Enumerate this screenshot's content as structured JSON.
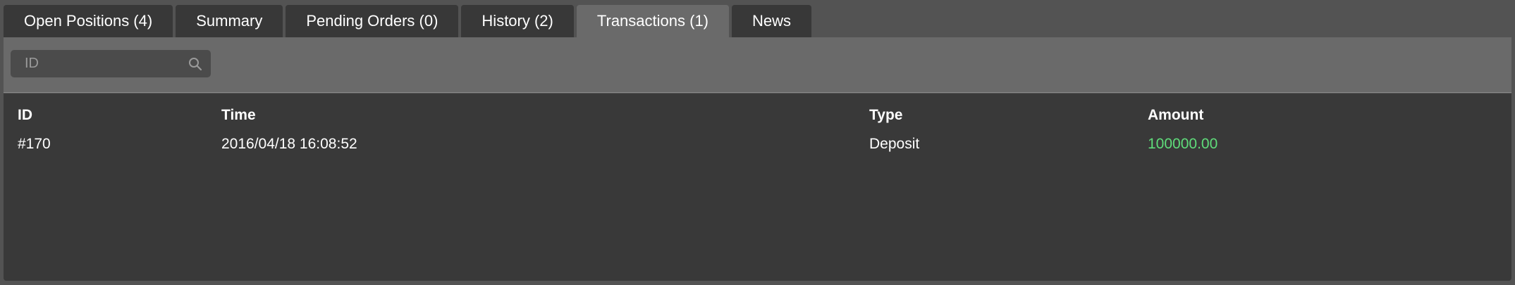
{
  "tabs": [
    {
      "label": "Open Positions (4)",
      "active": false
    },
    {
      "label": "Summary",
      "active": false
    },
    {
      "label": "Pending Orders (0)",
      "active": false
    },
    {
      "label": "History (2)",
      "active": false
    },
    {
      "label": "Transactions (1)",
      "active": true
    },
    {
      "label": "News",
      "active": false
    }
  ],
  "search": {
    "placeholder": "ID",
    "value": "",
    "icon": "search-icon"
  },
  "table": {
    "headers": {
      "id": "ID",
      "time": "Time",
      "type": "Type",
      "amount": "Amount"
    },
    "rows": [
      {
        "id": "#170",
        "time": "2016/04/18 16:08:52",
        "type": "Deposit",
        "amount": "100000.00"
      }
    ]
  },
  "colors": {
    "amount_positive": "#5fdc7a",
    "panel_bg": "#393939",
    "toolbar_bg": "#6a6a6a",
    "tab_bg": "#383838",
    "tab_active_bg": "#6a6a6a"
  }
}
